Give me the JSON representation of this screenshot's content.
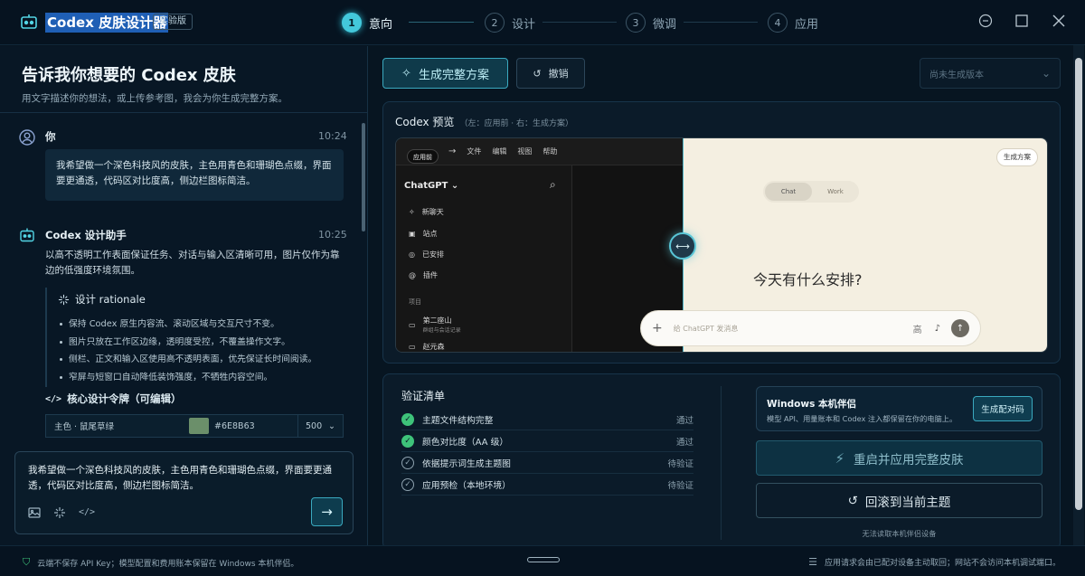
{
  "app": {
    "title": "Codex 皮肤设计器",
    "badge": "实验版"
  },
  "steps": [
    {
      "num": "1",
      "label": "意向"
    },
    {
      "num": "2",
      "label": "设计"
    },
    {
      "num": "3",
      "label": "微调"
    },
    {
      "num": "4",
      "label": "应用"
    }
  ],
  "left": {
    "title": "告诉我你想要的 Codex 皮肤",
    "subtitle": "用文字描述你的想法，或上传参考图，我会为你生成完整方案。",
    "user_msg": {
      "name": "你",
      "time": "10:24",
      "text": "我希望做一个深色科技风的皮肤，主色用青色和珊瑚色点缀，界面要更通透，代码区对比度高，侧边栏图标简洁。"
    },
    "assistant_msg": {
      "name": "Codex 设计助手",
      "time": "10:25",
      "text": "以高不透明工作表面保证任务、对话与输入区清晰可用，图片仅作为靠边的低强度环境氛围。",
      "rationale_title": "设计 rationale",
      "rationale": [
        "保持 Codex 原生内容流、滚动区域与交互尺寸不变。",
        "图片只放在工作区边缘，透明度受控，不覆盖操作文字。",
        "侧栏、正文和输入区使用高不透明表面，优先保证长时间阅读。",
        "窄屏与短窗口自动降低装饰强度，不牺牲内容空间。"
      ],
      "tokens_title": "核心设计令牌（可编辑）",
      "token": {
        "label": "主色 · 鼠尾草绿",
        "hex": "#6E8B63",
        "weight": "500",
        "color": "#6b8f6a"
      }
    },
    "input": {
      "text": "我希望做一个深色科技风的皮肤，主色用青色和珊瑚色点缀，界面要更通透，代码区对比度高，侧边栏图标简洁。"
    }
  },
  "toolbar": {
    "generate": "生成完整方案",
    "undo": "撤销",
    "version_placeholder": "尚未生成版本"
  },
  "preview": {
    "title": "Codex 预览",
    "hint": "（左：应用前 · 右：生成方案）",
    "before_badge": "应用前",
    "after_badge": "生成方案",
    "menu": [
      "文件",
      "编辑",
      "视图",
      "帮助"
    ],
    "app_name": "ChatGPT",
    "nav": [
      "新聊天",
      "站点",
      "已安排",
      "插件"
    ],
    "section": "项目",
    "projects": [
      "第二座山",
      "赵元森"
    ],
    "project_sub": "群组与会话记录",
    "toggle": [
      "Chat",
      "Work"
    ],
    "question": "今天有什么安排?",
    "input_placeholder": "给 ChatGPT 发消息",
    "input_mode": "高"
  },
  "checks": {
    "title": "验证清单",
    "items": [
      {
        "label": "主题文件结构完整",
        "status": "通过",
        "state": "pass"
      },
      {
        "label": "颜色对比度（AA 级）",
        "status": "通过",
        "state": "pass"
      },
      {
        "label": "依据提示词生成主题图",
        "status": "待验证",
        "state": "pending"
      },
      {
        "label": "应用预检（本地环境）",
        "status": "待验证",
        "state": "pending"
      }
    ]
  },
  "companion": {
    "title": "Windows 本机伴侣",
    "desc": "模型 API、用量账本和 Codex 注入都保留在你的电脑上。",
    "pair_button": "生成配对码",
    "restart_button": "重启并应用完整皮肤",
    "rollback_button": "回滚到当前主题",
    "no_device": "无法读取本机伴侣设备"
  },
  "footer": {
    "left": "云端不保存 API Key；模型配置和费用账本保留在 Windows 本机伴侣。",
    "right": "应用请求会由已配对设备主动取回；网站不会访问本机调试端口。"
  },
  "colors": {
    "accent": "#43c8db",
    "background": "#071521",
    "pass": "#3ec37a"
  }
}
